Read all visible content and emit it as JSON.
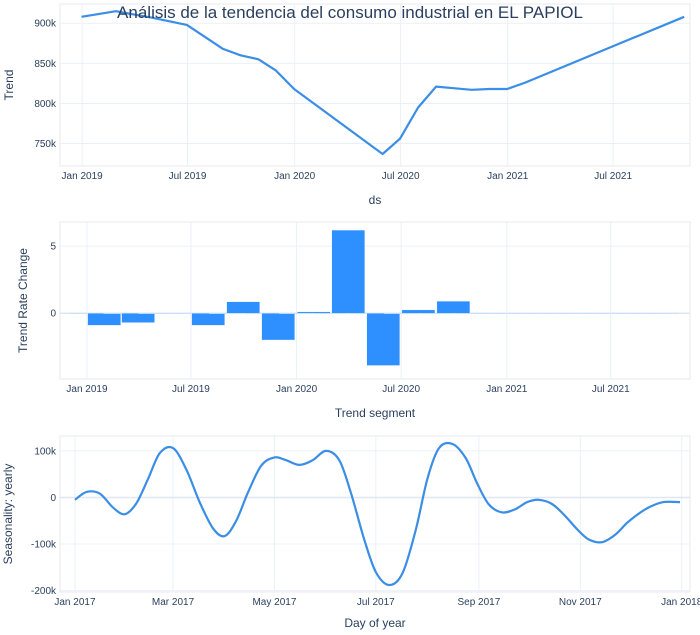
{
  "title": "Análisis de la tendencia del consumo industrial en EL PAPIOL",
  "colors": {
    "line": "#3a8ee6",
    "bar": "#2e90ff",
    "grid": "#ebf0f8",
    "zero": "#dfe7f3",
    "frame": "#e5eaf2",
    "text": "#2a3f5f"
  },
  "chart_data": [
    {
      "type": "line",
      "name": "trend",
      "xlabel": "ds",
      "ylabel": "Trend",
      "x_ticks": [
        "Jan 2019",
        "Jul 2019",
        "Jan 2020",
        "Jul 2020",
        "Jan 2021",
        "Jul 2021"
      ],
      "y_ticks": [
        "750k",
        "800k",
        "850k",
        "900k"
      ],
      "ylim": [
        722000,
        924000
      ],
      "x": [
        "2018-12-31",
        "2019-02-28",
        "2019-04-30",
        "2019-06-30",
        "2019-07-31",
        "2019-08-31",
        "2019-09-30",
        "2019-10-31",
        "2019-11-30",
        "2019-12-31",
        "2020-05-31",
        "2020-06-30",
        "2020-07-31",
        "2020-08-31",
        "2020-09-30",
        "2020-10-31",
        "2020-11-30",
        "2020-12-31",
        "2021-01-31",
        "2021-10-31"
      ],
      "y": [
        908000,
        915000,
        907000,
        898000,
        883000,
        868000,
        860000,
        855000,
        841000,
        818000,
        737000,
        756000,
        795000,
        821000,
        819000,
        817000,
        818000,
        818000,
        826000,
        908000
      ]
    },
    {
      "type": "bar",
      "name": "trend_rate_change",
      "xlabel": "Trend segment",
      "ylabel": "Trend Rate Change",
      "x_ticks": [
        "Jan 2019",
        "Jul 2019",
        "Jan 2020",
        "Jul 2020",
        "Jan 2021",
        "Jul 2021"
      ],
      "y_ticks": [
        "0",
        "5"
      ],
      "ylim": [
        -4.9,
        6.8
      ],
      "x": [
        "2018-12-31",
        "2019-01-31",
        "2019-02-28",
        "2019-03-31",
        "2019-04-30",
        "2019-05-31",
        "2019-06-30",
        "2019-07-31",
        "2019-08-31",
        "2019-09-30",
        "2019-10-31",
        "2019-11-30",
        "2019-12-31",
        "2020-01-31",
        "2020-02-29",
        "2020-03-31",
        "2020-04-30",
        "2020-05-31",
        "2020-06-30",
        "2020-07-31",
        "2020-08-31",
        "2020-09-30",
        "2020-10-31",
        "2020-11-30",
        "2020-12-31",
        "2021-01-31",
        "2021-02-28",
        "2021-03-31",
        "2021-04-30",
        "2021-05-31",
        "2021-06-30",
        "2021-07-31",
        "2021-08-31",
        "2021-09-30"
      ],
      "values": [
        0,
        -0.9,
        0,
        -0.7,
        0,
        0,
        0,
        -0.9,
        0,
        0.85,
        0,
        -2.0,
        0,
        0.1,
        0,
        6.2,
        0,
        -3.9,
        0,
        0.25,
        0,
        0.9,
        0,
        0,
        0,
        0,
        0,
        0,
        0,
        0,
        0,
        0,
        0,
        0
      ]
    },
    {
      "type": "line",
      "name": "yearly",
      "xlabel": "Day of year",
      "ylabel": "Seasonality: yearly",
      "x_ticks": [
        "Jan 2017",
        "Mar 2017",
        "May 2017",
        "Jul 2017",
        "Sep 2017",
        "Nov 2017",
        "Jan 2018"
      ],
      "y_ticks": [
        "-200k",
        "-100k",
        "0",
        "100k"
      ],
      "ylim": [
        -203000,
        132000
      ],
      "x": [
        1,
        8,
        16,
        24,
        31,
        38,
        45,
        52,
        60,
        68,
        76,
        84,
        91,
        98,
        105,
        113,
        121,
        128,
        136,
        144,
        152,
        160,
        167,
        175,
        182,
        190,
        198,
        206,
        213,
        220,
        228,
        236,
        243,
        250,
        258,
        266,
        273,
        280,
        288,
        296,
        303,
        310,
        318,
        326,
        333,
        340,
        347,
        355,
        365
      ],
      "y": [
        -5000,
        12000,
        8000,
        -22000,
        -36000,
        -12000,
        40000,
        95000,
        106000,
        60000,
        -10000,
        -66000,
        -83000,
        -50000,
        10000,
        68000,
        86000,
        80000,
        70000,
        80000,
        100000,
        80000,
        10000,
        -90000,
        -160000,
        -188000,
        -163000,
        -70000,
        40000,
        106000,
        115000,
        85000,
        30000,
        -15000,
        -32000,
        -25000,
        -10000,
        -5000,
        -14000,
        -40000,
        -68000,
        -90000,
        -96000,
        -80000,
        -55000,
        -35000,
        -20000,
        -10000,
        -10000
      ]
    }
  ]
}
